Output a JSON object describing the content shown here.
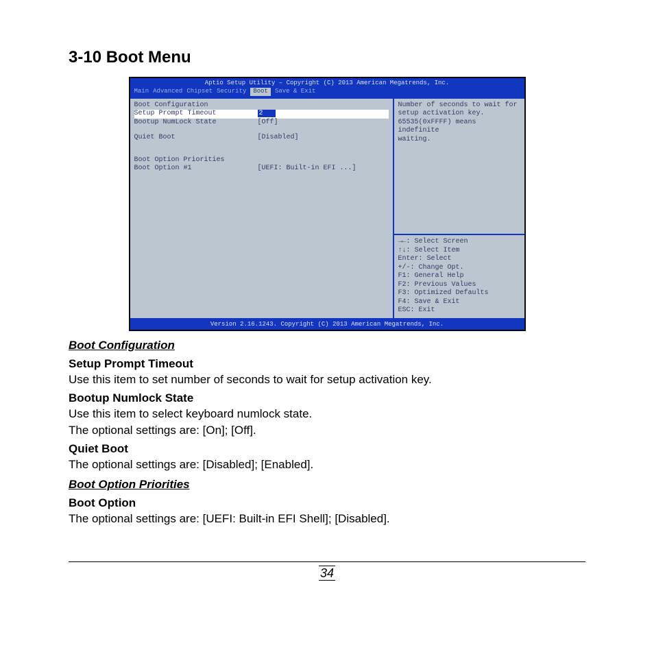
{
  "section_title": "3-10 Boot Menu",
  "bios": {
    "header": "Aptio Setup Utility – Copyright (C) 2013 American Megatrends, Inc.",
    "tabs": {
      "main": "Main",
      "advanced": "Advanced",
      "chipset": "Chipset",
      "security": "Security",
      "boot": "Boot",
      "save_exit": "Save & Exit"
    },
    "left": {
      "group1_title": "Boot Configuration",
      "row1_label": "Setup Prompt Timeout",
      "row1_value": "2",
      "row2_label": "Bootup NumLock State",
      "row2_value": "[Off]",
      "row3_label": "Quiet Boot",
      "row3_value": "[Disabled]",
      "group2_title": "Boot Option Priorities",
      "row4_label": "Boot Option #1",
      "row4_value": "[UEFI: Built-in EFI ...]"
    },
    "right": {
      "help1": "Number of seconds to wait for",
      "help2": "setup activation key.",
      "help3": "65535(0xFFFF) means indefinite",
      "help4": "waiting.",
      "k1": "→←: Select Screen",
      "k2": "↑↓: Select Item",
      "k3": "Enter: Select",
      "k4": "+/-: Change Opt.",
      "k5": "F1: General Help",
      "k6": "F2: Previous Values",
      "k7": "F3: Optimized Defaults",
      "k8": "F4: Save & Exit",
      "k9": "ESC: Exit"
    },
    "footer": "Version 2.16.1243. Copyright (C) 2013 American Megatrends, Inc."
  },
  "doc": {
    "subhead1": "Boot Configuration",
    "item1_title": "Setup Prompt Timeout",
    "item1_desc": "Use this item to set number of seconds to wait for setup activation key.",
    "item2_title": "Bootup Numlock State",
    "item2_desc1": "Use this item to select keyboard numlock state.",
    "item2_desc2": "The optional settings are: [On]; [Off].",
    "item3_title": "Quiet Boot",
    "item3_desc": "The optional settings are: [Disabled]; [Enabled].",
    "subhead2": "Boot Option Priorities",
    "item4_title": "Boot Option",
    "item4_desc": "The optional settings are: [UEFI: Built-in EFI Shell]; [Disabled]."
  },
  "page_number": "34"
}
